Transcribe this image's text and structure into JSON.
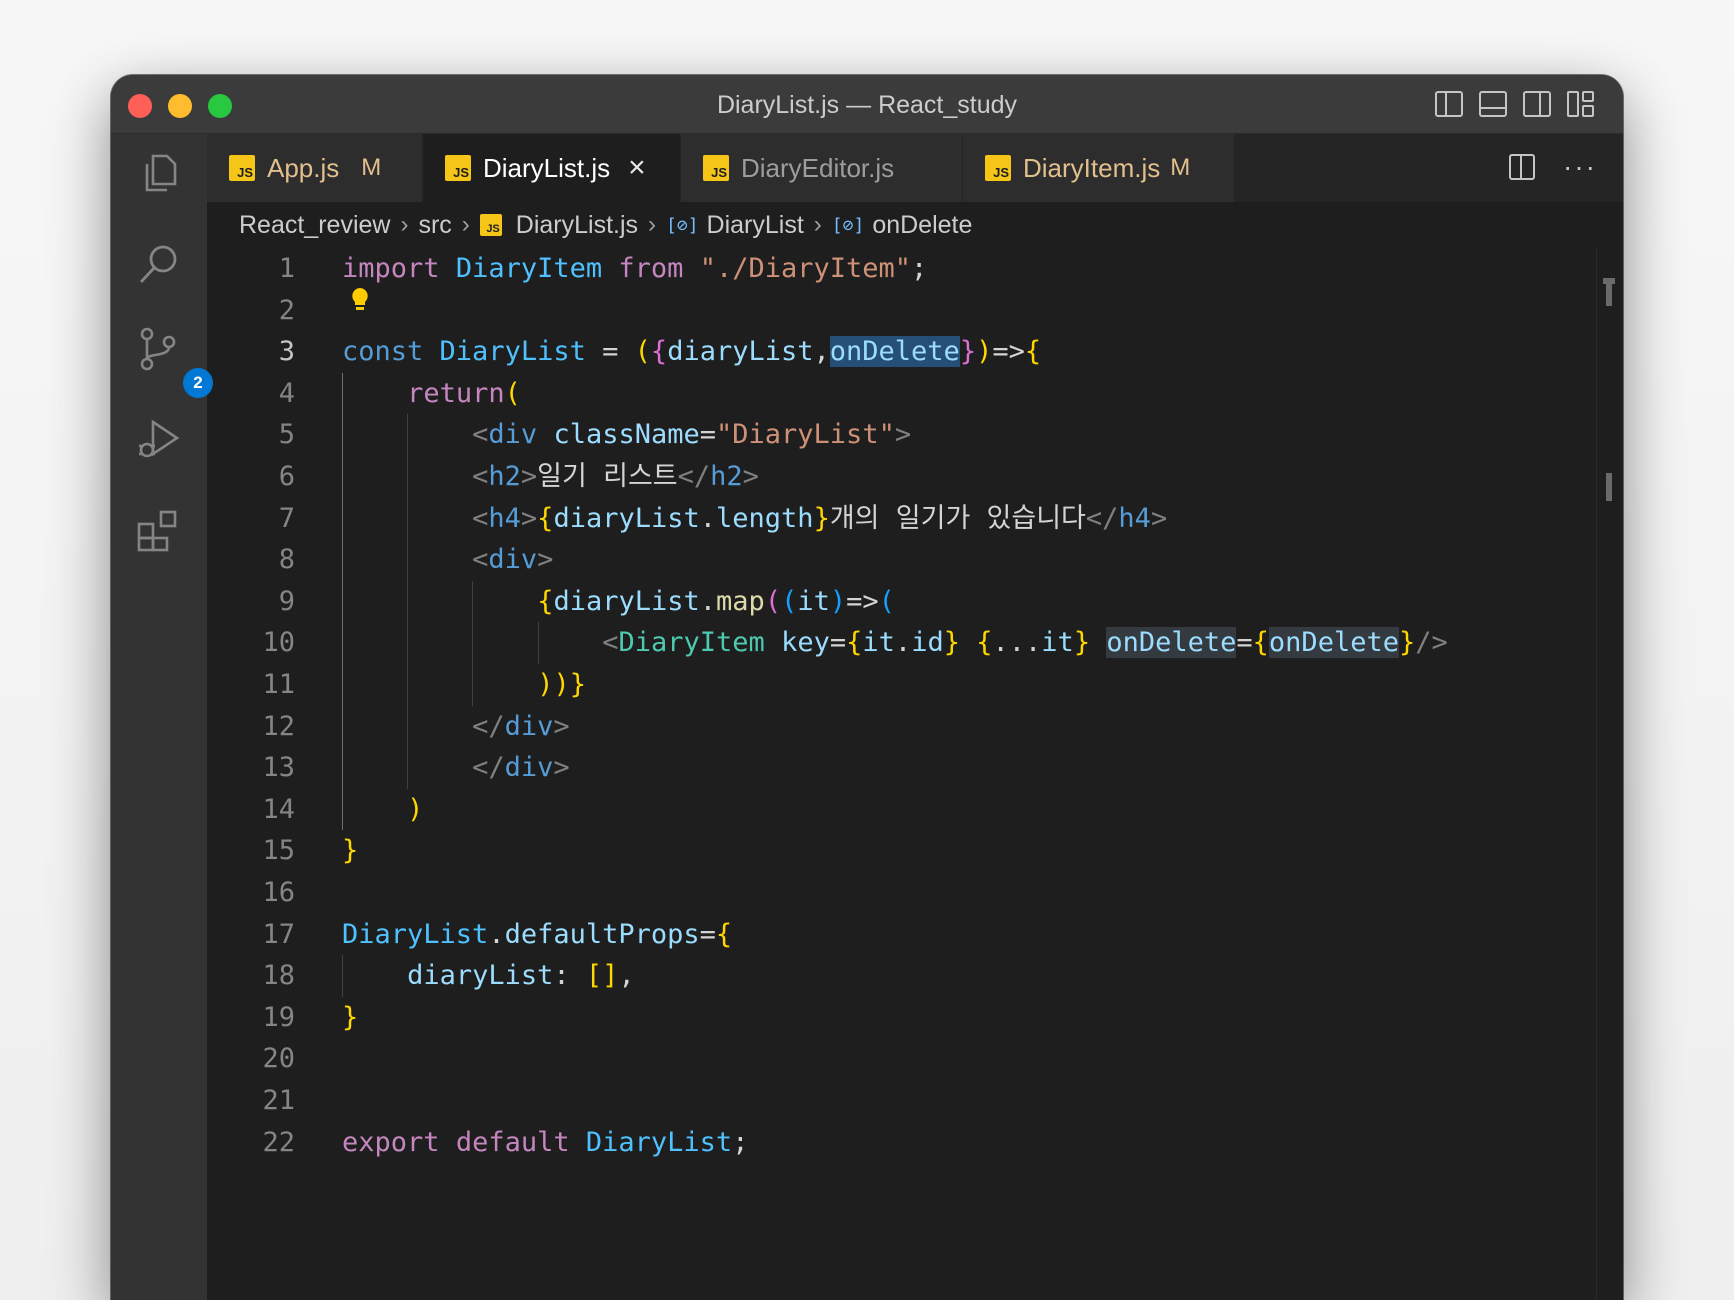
{
  "window": {
    "title": "DiaryList.js — React_study"
  },
  "activity_bar": {
    "scm_badge": "2"
  },
  "tabs": [
    {
      "label": "App.js",
      "status": "M",
      "label_color": "#e2c08d",
      "active": false
    },
    {
      "label": "DiaryList.js",
      "status": "",
      "label_color": "#ffffff",
      "active": true
    },
    {
      "label": "DiaryEditor.js",
      "status": "",
      "label_color": "#9d9d9d",
      "active": false
    },
    {
      "label": "DiaryItem.js",
      "status": "M",
      "label_color": "#e2c08d",
      "active": false
    }
  ],
  "tab_icon_text": "JS",
  "tab_close": "×",
  "editor_more": "···",
  "breadcrumb": {
    "items": [
      "React_review",
      "src",
      "DiaryList.js",
      "DiaryList",
      "onDelete"
    ]
  },
  "editor": {
    "current_line": 3,
    "line_numbers": [
      "1",
      "2",
      "3",
      "4",
      "5",
      "6",
      "7",
      "8",
      "9",
      "10",
      "11",
      "12",
      "13",
      "14",
      "15",
      "16",
      "17",
      "18",
      "19",
      "20",
      "21",
      "22"
    ],
    "lines": [
      "import DiaryItem from \"./DiaryItem\";",
      "",
      "const DiaryList = ({diaryList,onDelete})=>{",
      "    return(",
      "        <div className=\"DiaryList\">",
      "        <h2>일기 리스트</h2>",
      "        <h4>{diaryList.length}개의 일기가 있습니다</h4>",
      "        <div>",
      "            {diaryList.map((it)=>(",
      "                <DiaryItem key={it.id} {...it} onDelete={onDelete}/>",
      "            ))}",
      "        </div>",
      "        </div>",
      "    )",
      "}",
      "",
      "DiaryList.defaultProps={",
      "    diaryList: [],",
      "}",
      "",
      "",
      "export default DiaryList;"
    ]
  },
  "colors": {
    "accent": "#0078d4",
    "selection": "#264f78",
    "modified": "#e2c08d",
    "js_icon": "#f5c518"
  }
}
